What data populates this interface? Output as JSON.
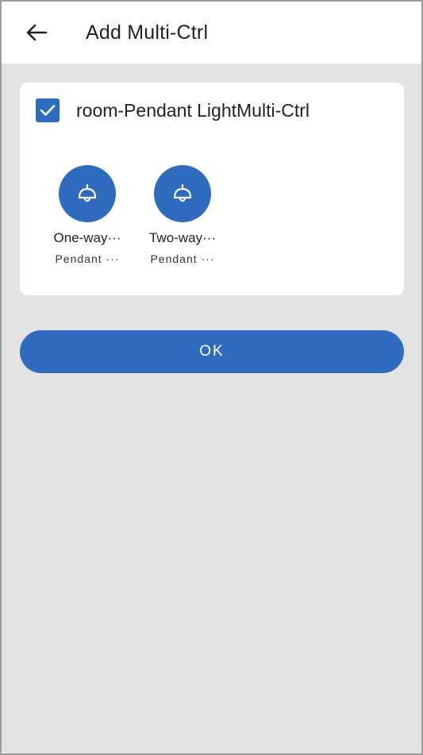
{
  "header": {
    "title": "Add Multi-Ctrl",
    "back_icon": "arrow-left-icon"
  },
  "group": {
    "label": "room-Pendant LightMulti-Ctrl",
    "checked": true
  },
  "devices": [
    {
      "name": "One-way···",
      "subtitle": "Pendant ···",
      "icon": "pendant-lamp-icon"
    },
    {
      "name": "Two-way···",
      "subtitle": "Pendant ···",
      "icon": "pendant-lamp-icon"
    }
  ],
  "actions": {
    "ok_label": "OK"
  },
  "colors": {
    "accent": "#2f6cbf",
    "background": "#e3e3e3",
    "card": "#ffffff"
  }
}
